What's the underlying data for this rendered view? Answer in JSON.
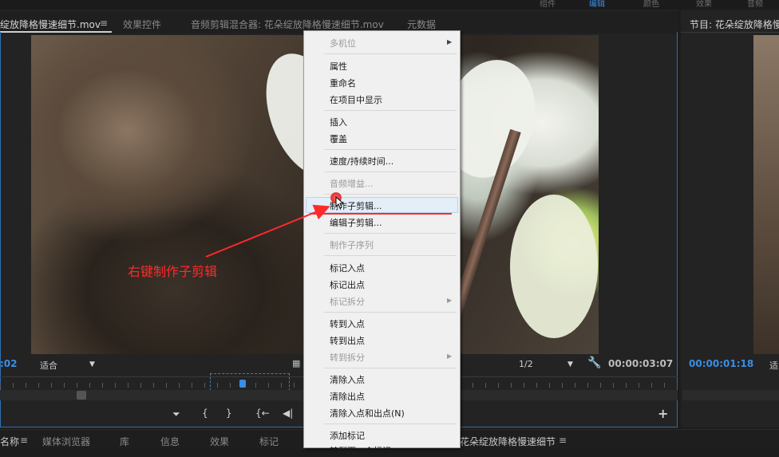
{
  "workspace_tabs": [
    "组件",
    "编辑",
    "颜色",
    "效果",
    "音频"
  ],
  "workspace_active": "编辑",
  "source_monitor": {
    "tabs": [
      {
        "label": "绽放降格慢速细节.mov",
        "active": true
      },
      {
        "label": "效果控件",
        "active": false
      },
      {
        "label": "音频剪辑混合器: 花朵绽放降格慢速细节.mov",
        "active": false
      },
      {
        "label": "元数据",
        "active": false
      }
    ],
    "menu_glyph": "≡",
    "timecode_left": ":02",
    "fit_select": "适合",
    "resolution_select": "1/2",
    "duration": "00:00:03:07",
    "transport": {
      "marker": "⏷",
      "mark_in": "{",
      "mark_out": "}",
      "go_to_in": "{←",
      "step_back": "◀|",
      "add": "+"
    }
  },
  "program_monitor": {
    "title": "节目: 花朵绽放降格慢速细节",
    "timecode": "00:00:01:18",
    "fit_select": "适"
  },
  "bottom_tabs": [
    "名称",
    "媒体浏览器",
    "库",
    "信息",
    "效果",
    "标记",
    "花朵绽放降格慢速细节"
  ],
  "bottom_menu_glyph": "≡",
  "context_menu": {
    "groups": [
      [
        {
          "label": "多机位",
          "disabled": true,
          "submenu": true
        }
      ],
      [
        {
          "label": "属性"
        },
        {
          "label": "重命名"
        },
        {
          "label": "在项目中显示"
        }
      ],
      [
        {
          "label": "插入"
        },
        {
          "label": "覆盖"
        }
      ],
      [
        {
          "label": "速度/持续时间..."
        }
      ],
      [
        {
          "label": "音频增益...",
          "disabled": true
        }
      ],
      [
        {
          "label": "制作子剪辑...",
          "highlighted": true
        },
        {
          "label": "编辑子剪辑..."
        }
      ],
      [
        {
          "label": "制作子序列",
          "disabled": true
        }
      ],
      [
        {
          "label": "标记入点"
        },
        {
          "label": "标记出点"
        },
        {
          "label": "标记拆分",
          "disabled": true,
          "submenu": true
        }
      ],
      [
        {
          "label": "转到入点"
        },
        {
          "label": "转到出点"
        },
        {
          "label": "转到拆分",
          "disabled": true,
          "submenu": true
        }
      ],
      [
        {
          "label": "清除入点"
        },
        {
          "label": "清除出点"
        },
        {
          "label": "清除入点和出点(N)"
        }
      ],
      [
        {
          "label": "添加标记"
        },
        {
          "label": "转到下一个标记"
        }
      ]
    ]
  },
  "annotation": {
    "text": "右键制作子剪辑",
    "color": "#ff2a2a"
  },
  "colors": {
    "accent_blue": "#3a8ee6",
    "panel_border": "#2f6fb2"
  }
}
